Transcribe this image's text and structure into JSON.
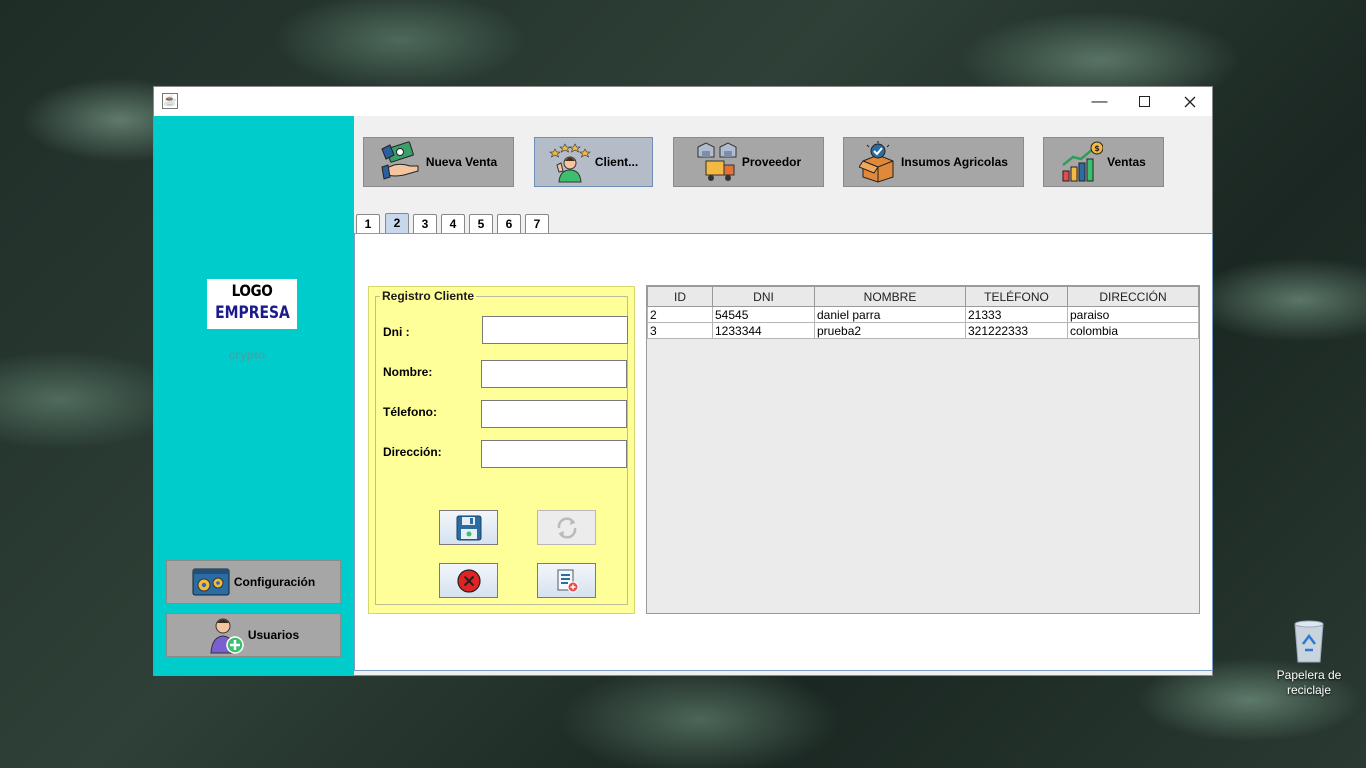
{
  "window": {
    "title": ""
  },
  "sidebar": {
    "logo_line1": "LOGO",
    "logo_line2": "EMPRESA",
    "company": "crypto",
    "buttons": [
      {
        "label": "Configuración",
        "icon": "settings-icon"
      },
      {
        "label": "Usuarios",
        "icon": "add-user-icon"
      }
    ]
  },
  "toolbar": {
    "buttons": [
      {
        "label": "Nueva Venta",
        "icon": "money-hand-icon"
      },
      {
        "label": "Client...",
        "icon": "customers-icon",
        "active": true
      },
      {
        "label": "Proveedor",
        "icon": "supplier-icon"
      },
      {
        "label": "Insumos Agricolas",
        "icon": "box-icon"
      },
      {
        "label": "Ventas",
        "icon": "sales-chart-icon"
      }
    ]
  },
  "tabs": [
    "1",
    "2",
    "3",
    "4",
    "5",
    "6",
    "7"
  ],
  "active_tab": "2",
  "form": {
    "legend": "Registro Cliente",
    "fields": [
      {
        "label": "Dni :",
        "value": ""
      },
      {
        "label": "Nombre:",
        "value": ""
      },
      {
        "label": "Télefono:",
        "value": ""
      },
      {
        "label": "Dirección:",
        "value": ""
      }
    ],
    "buttons": [
      "save-icon",
      "update-icon",
      "delete-icon",
      "report-icon"
    ]
  },
  "table": {
    "columns": [
      "ID",
      "DNI",
      "NOMBRE",
      "TELÉFONO",
      "DIRECCIÓN"
    ],
    "rows": [
      [
        "2",
        "54545",
        "daniel parra",
        "21333",
        "paraiso"
      ],
      [
        "3",
        "1233344",
        "prueba2",
        "321222333",
        "colombia"
      ]
    ]
  },
  "desktop": {
    "recycle_bin_label": "Papelera de reciclaje"
  },
  "colors": {
    "sidebar": "#00cccc",
    "form_panel": "#ffff99",
    "button": "#a6a6a6"
  }
}
